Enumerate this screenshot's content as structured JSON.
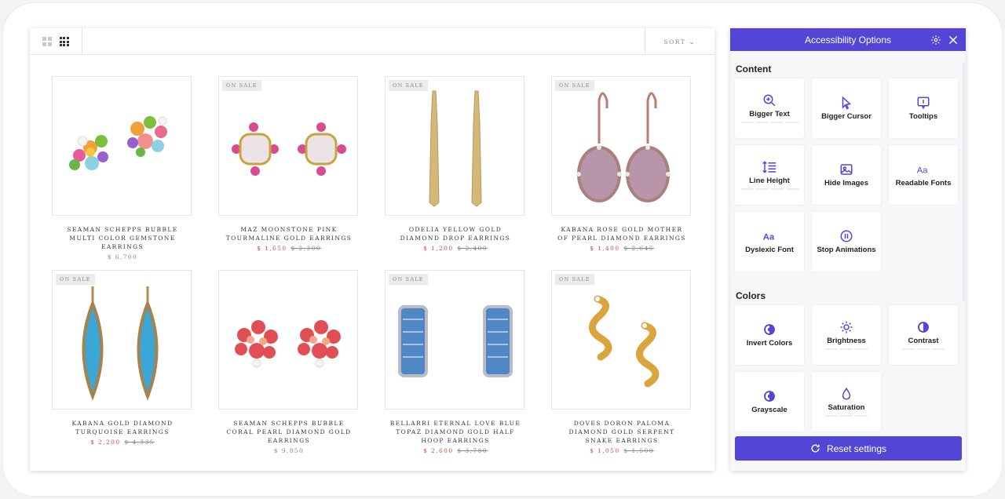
{
  "toolbar": {
    "sort_label": "SORT",
    "sort_icon": "chevron-down-icon",
    "view_icons": [
      "grid-2-icon",
      "grid-3-icon"
    ]
  },
  "products": [
    {
      "name": "SEAMAN SCHEPPS BUBBLE MULTI COLOR GEMSTONE EARRINGS",
      "price": "$ 6,700",
      "was": "",
      "on_sale": false,
      "badge": ""
    },
    {
      "name": "MAZ MOONSTONE PINK TOURMALINE GOLD EARRINGS",
      "price": "$ 1,650",
      "was": "$ 2,300",
      "on_sale": true,
      "badge": "ON SALE"
    },
    {
      "name": "ODELIA YELLOW GOLD DIAMOND DROP EARRINGS",
      "price": "$ 1,200",
      "was": "$ 2,400",
      "on_sale": true,
      "badge": "ON SALE"
    },
    {
      "name": "KABANA ROSE GOLD MOTHER OF PEARL DIAMOND EARRINGS",
      "price": "$ 1,400",
      "was": "$ 2,645",
      "on_sale": true,
      "badge": "ON SALE"
    },
    {
      "name": "KABANA GOLD DIAMOND TURQUOISE EARRINGS",
      "price": "$ 2,200",
      "was": "$ 4,335",
      "on_sale": true,
      "badge": "ON SALE"
    },
    {
      "name": "SEAMAN SCHEPPS BUBBLE CORAL PEARL DIAMOND GOLD EARRINGS",
      "price": "$ 9,850",
      "was": "",
      "on_sale": false,
      "badge": ""
    },
    {
      "name": "BELLARRI ETERNAL LOVE BLUE TOPAZ DIAMOND GOLD HALF HOOP EARRINGS",
      "price": "$ 2,600",
      "was": "$ 3,780",
      "on_sale": true,
      "badge": "ON SALE"
    },
    {
      "name": "DOVES DORON PALOMA DIAMOND GOLD SERPENT SNAKE EARRINGS",
      "price": "$ 1,050",
      "was": "$ 1,500",
      "on_sale": true,
      "badge": "ON SALE"
    }
  ],
  "a11y": {
    "title": "Accessibility Options",
    "content_heading": "Content",
    "colors_heading": "Colors",
    "content_options": [
      {
        "label": "Bigger Text",
        "icon": "zoom-in-icon",
        "bars": true
      },
      {
        "label": "Bigger Cursor",
        "icon": "cursor-icon",
        "bars": false
      },
      {
        "label": "Tooltips",
        "icon": "tooltip-icon",
        "bars": false
      },
      {
        "label": "Line Height",
        "icon": "line-height-icon",
        "bars": true
      },
      {
        "label": "Hide Images",
        "icon": "image-icon",
        "bars": false
      },
      {
        "label": "Readable Fonts",
        "icon": "font-icon",
        "bars": false
      },
      {
        "label": "Dyslexic Font",
        "icon": "font-icon",
        "bars": false
      },
      {
        "label": "Stop Animations",
        "icon": "pause-icon",
        "bars": false
      }
    ],
    "color_options": [
      {
        "label": "Invert Colors",
        "icon": "invert-icon",
        "bars": false
      },
      {
        "label": "Brightness",
        "icon": "sun-icon",
        "bars": true
      },
      {
        "label": "Contrast",
        "icon": "contrast-icon",
        "bars": true
      },
      {
        "label": "Grayscale",
        "icon": "invert-icon",
        "bars": false
      },
      {
        "label": "Saturation",
        "icon": "droplet-icon",
        "bars": true
      }
    ],
    "reset_label": "Reset settings",
    "accent": "#5346d6"
  },
  "colors": {
    "sale_price": "#c94d4d",
    "muted": "#888888"
  }
}
